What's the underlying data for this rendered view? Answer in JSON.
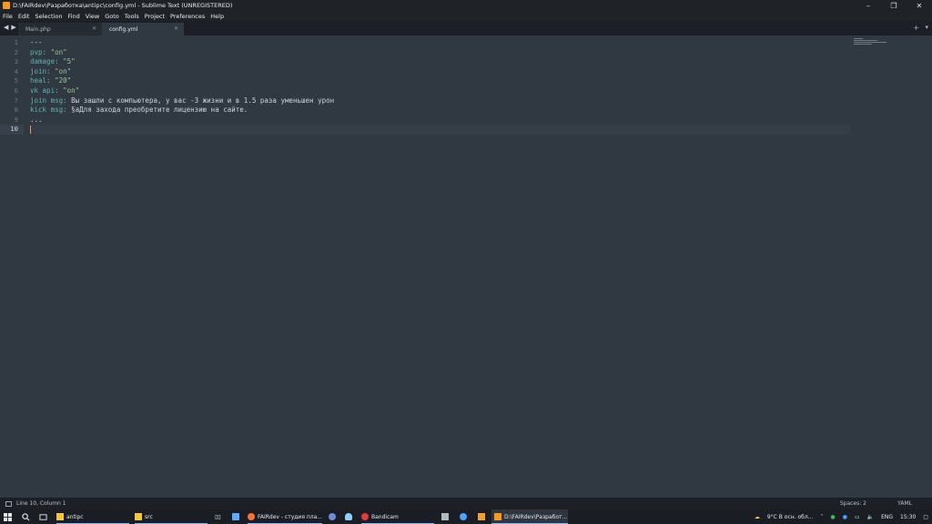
{
  "window": {
    "title": "D:\\FAIRdev\\Разработка\\antipc\\config.yml - Sublime Text (UNREGISTERED)",
    "controls": [
      "–",
      "❐",
      "✕"
    ]
  },
  "menu": [
    "File",
    "Edit",
    "Selection",
    "Find",
    "View",
    "Goto",
    "Tools",
    "Project",
    "Preferences",
    "Help"
  ],
  "tabs": [
    {
      "label": "Main.php",
      "active": false
    },
    {
      "label": "config.yml",
      "active": true
    }
  ],
  "tabbar": {
    "nav_left": "◀",
    "nav_right": "▶",
    "plus": "+",
    "dropdown": "▾",
    "close": "✕"
  },
  "editor": {
    "line_numbers": [
      "1",
      "2",
      "3",
      "4",
      "5",
      "6",
      "7",
      "8",
      "9",
      "10"
    ],
    "active_line": 10,
    "lines": [
      [
        {
          "t": "---",
          "c": "p"
        }
      ],
      [
        {
          "t": "pvp:",
          "c": "k"
        },
        {
          "t": " \"on\"",
          "c": "s"
        }
      ],
      [
        {
          "t": "damage:",
          "c": "k"
        },
        {
          "t": " \"5\"",
          "c": "s"
        }
      ],
      [
        {
          "t": "join:",
          "c": "k"
        },
        {
          "t": " \"on\"",
          "c": "s"
        }
      ],
      [
        {
          "t": "heal:",
          "c": "k"
        },
        {
          "t": " \"20\"",
          "c": "s"
        }
      ],
      [
        {
          "t": "vk api:",
          "c": "k"
        },
        {
          "t": " \"on\"",
          "c": "s"
        }
      ],
      [
        {
          "t": "join msg:",
          "c": "k"
        },
        {
          "t": " Вы зашли с компьютера, у вас -3 жизни и в 1.5 раза уменьшен урон",
          "c": "p"
        }
      ],
      [
        {
          "t": "kick msg:",
          "c": "k"
        },
        {
          "t": " §aДля захода преобретите лицензию на сайте.",
          "c": "p"
        }
      ],
      [
        {
          "t": "...",
          "c": "p"
        }
      ],
      []
    ]
  },
  "status": {
    "position": "Line 10, Column 1",
    "spaces": "Spaces: 2",
    "syntax": "YAML"
  },
  "taskbar": {
    "items": [
      {
        "label": "antipc",
        "icon": "folder-icon",
        "color": "#f4c542"
      },
      {
        "label": "src",
        "icon": "folder-icon",
        "color": "#f4c542"
      },
      {
        "label": "FAIRdev - студия пла...",
        "icon": "firefox-icon",
        "color": "#ff7139"
      },
      {
        "label": "Bandicam",
        "icon": "bandicam-icon",
        "color": "#e23b3b"
      },
      {
        "label": "D:\\FAIRdev\\Разработ...",
        "icon": "sublime-icon",
        "color": "#f79a1b"
      }
    ],
    "weather": "9°C  В осн. обл...",
    "lang": "ENG",
    "time": "15:30"
  }
}
